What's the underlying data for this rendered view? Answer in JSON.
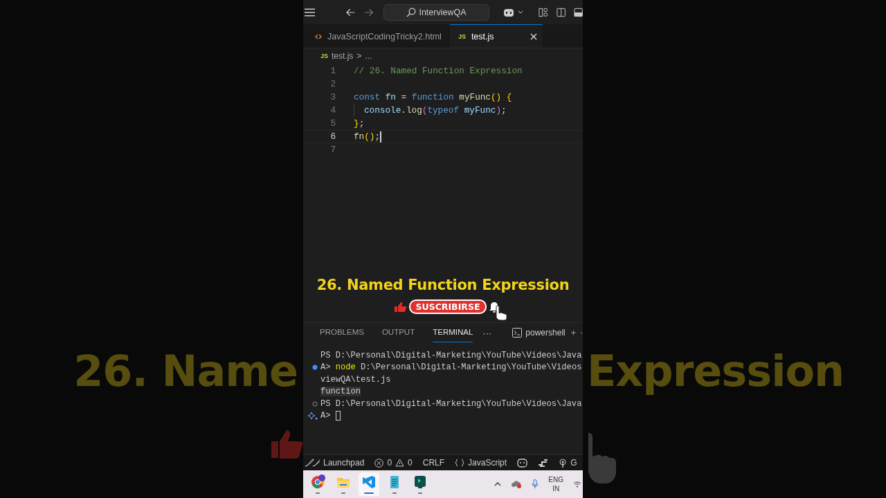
{
  "backdrop": {
    "left_text": "26. Name",
    "right_text": "Expression"
  },
  "title_bar": {
    "search": "InterviewQA"
  },
  "editor_tabs": [
    {
      "label": "JavaScriptCodingTricky2.html",
      "kind": "html",
      "selected": false
    },
    {
      "label": "test.js",
      "kind": "js",
      "badge": "JS",
      "selected": true
    }
  ],
  "breadcrumb": {
    "badge": "JS",
    "file": "test.js",
    "separator": ">",
    "rest": "..."
  },
  "code": [
    {
      "number": "1",
      "current": false,
      "tokens": [
        {
          "text": "// 26. Named Function Expression",
          "kind": "comment"
        }
      ]
    },
    {
      "number": "2",
      "current": false
    },
    {
      "number": "3",
      "current": false,
      "tokens": [
        {
          "text": "const",
          "kind": "keyword"
        },
        {
          "text": " fn",
          "kind": "variable"
        },
        {
          "text": " = ",
          "kind": "plain"
        },
        {
          "text": "function",
          "kind": "keyword"
        },
        {
          "text": " myFunc",
          "kind": "function"
        },
        {
          "text": "()",
          "kind": "bracket"
        },
        {
          "text": " {",
          "kind": "bracket"
        }
      ]
    },
    {
      "number": "4",
      "current": false,
      "indent": true,
      "tokens": [
        {
          "text": "console",
          "kind": "variable"
        },
        {
          "text": ".",
          "kind": "plain"
        },
        {
          "text": "log",
          "kind": "function"
        },
        {
          "text": "(",
          "kind": "bracket2"
        },
        {
          "text": "typeof",
          "kind": "keyword"
        },
        {
          "text": " myFunc",
          "kind": "variable"
        },
        {
          "text": ")",
          "kind": "bracket2"
        },
        {
          "text": ";",
          "kind": "plain"
        }
      ]
    },
    {
      "number": "5",
      "current": false,
      "tokens": [
        {
          "text": "}",
          "kind": "bracket"
        },
        {
          "text": ";",
          "kind": "plain"
        }
      ]
    },
    {
      "number": "6",
      "current": true,
      "tokens": [
        {
          "text": "fn",
          "kind": "function"
        },
        {
          "text": "()",
          "kind": "bracket"
        },
        {
          "text": ";",
          "kind": "plain"
        }
      ]
    },
    {
      "number": "7",
      "current": false
    }
  ],
  "overlay": {
    "title": "26. Named Function Expression",
    "subscribe": "SUSCRIBIRSE"
  },
  "panel_tabs": [
    {
      "label": "PROBLEMS",
      "selected": false
    },
    {
      "label": "OUTPUT",
      "selected": false
    },
    {
      "label": "TERMINAL",
      "selected": true
    }
  ],
  "panel_more": "···",
  "terminal_name": "powershell",
  "terminal": [
    {
      "kind": "plain",
      "tokens": [
        {
          "text": "PS D:\\Personal\\Digital-Marketing\\YouTube\\Videos\\Java",
          "kind": "plain"
        }
      ]
    },
    {
      "kind": "success",
      "tokens": [
        {
          "text": "A> ",
          "kind": "plain"
        },
        {
          "text": "node",
          "kind": "command"
        },
        {
          "text": " D:\\Personal\\Digital-Marketing\\YouTube\\Videos",
          "kind": "plain"
        }
      ]
    },
    {
      "kind": "plain",
      "tokens": [
        {
          "text": "viewQA\\test.js",
          "kind": "plain"
        }
      ]
    },
    {
      "kind": "plain",
      "tokens": [
        {
          "text": "function",
          "kind": "highlight"
        }
      ]
    },
    {
      "kind": "idle",
      "tokens": [
        {
          "text": "PS D:\\Personal\\Digital-Marketing\\YouTube\\Videos\\Java",
          "kind": "plain"
        }
      ]
    },
    {
      "kind": "sparkle",
      "cursor": true,
      "tokens": [
        {
          "text": "A> ",
          "kind": "plain"
        }
      ]
    }
  ],
  "status_bar": [
    {
      "kind": "launchpad",
      "label": "Launchpad"
    },
    {
      "kind": "problems",
      "errors": "0",
      "warnings": "0"
    },
    {
      "kind": "text",
      "label": "CRLF"
    },
    {
      "kind": "language",
      "label": "JavaScript"
    },
    {
      "kind": "copilot"
    },
    {
      "kind": "ports"
    },
    {
      "kind": "golive",
      "label": "G"
    }
  ],
  "taskbar": {
    "apps": [
      {
        "kind": "chrome",
        "selected": false
      },
      {
        "kind": "files",
        "selected": false
      },
      {
        "kind": "vscode",
        "selected": true
      },
      {
        "kind": "notepad",
        "selected": false
      },
      {
        "kind": "terminal",
        "selected": false
      }
    ],
    "language": "ENG",
    "region": "IN"
  }
}
